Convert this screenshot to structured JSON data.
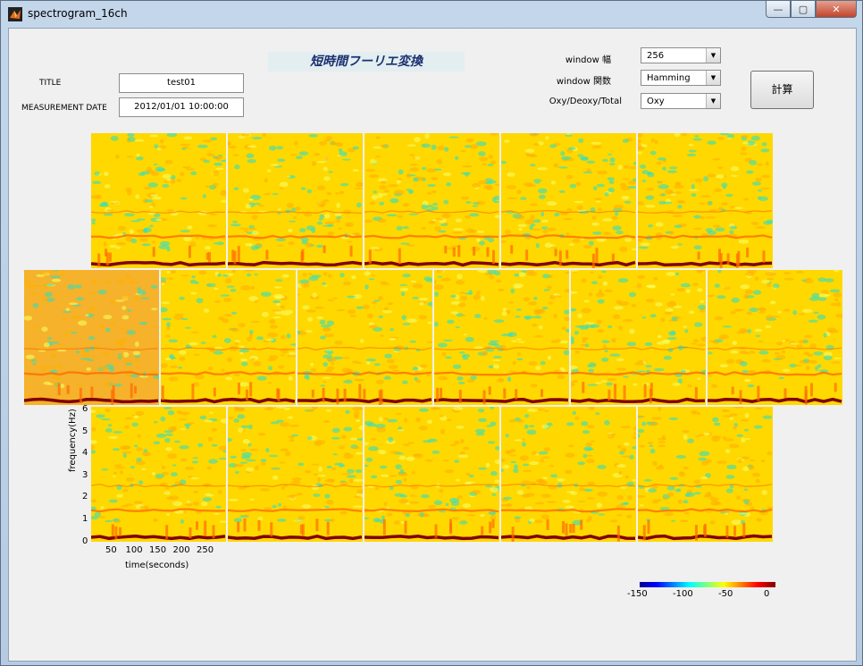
{
  "window": {
    "title": "spectrogram_16ch",
    "minimize_glyph": "—",
    "restore_glyph": "▢",
    "close_glyph": "✕"
  },
  "form": {
    "title_label": "TITLE",
    "title_value": "test01",
    "date_label": "MEASUREMENT DATE",
    "date_value": "2012/01/01 10:00:00"
  },
  "banner": "短時間フーリエ変換",
  "controls": {
    "window_width_label": "window 幅",
    "window_width_value": "256",
    "window_func_label": "window 関数",
    "window_func_value": "Hamming",
    "signal_label": "Oxy/Deoxy/Total",
    "signal_value": "Oxy",
    "calc_label": "計算"
  },
  "axes": {
    "ylabel": "frequency(Hz)",
    "xlabel": "time(seconds)",
    "yticks": [
      "6",
      "5",
      "4",
      "3",
      "2",
      "1",
      "0"
    ],
    "xticks": [
      "50",
      "100",
      "150",
      "200",
      "250"
    ]
  },
  "colorbar": {
    "ticks": [
      "-150",
      "-100",
      "-50",
      "0"
    ]
  },
  "colors": {
    "hot": "#800000",
    "warm": "#ff6a00",
    "mid": "#ffd800",
    "cool": "#30e0c0"
  },
  "chart_data": {
    "type": "heatmap",
    "channels": 16,
    "rows": [
      5,
      6,
      5
    ],
    "ylim": [
      0,
      6
    ],
    "xlim": [
      0,
      285
    ],
    "clim": [
      -150,
      0
    ]
  }
}
